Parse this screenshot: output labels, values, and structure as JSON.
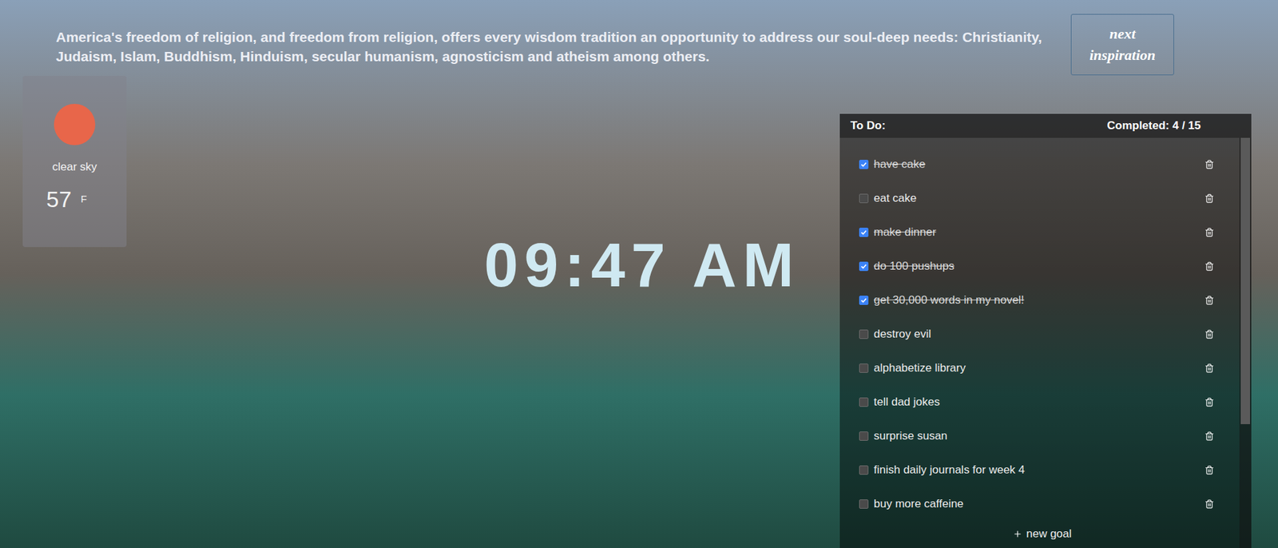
{
  "quote": {
    "text": "America's freedom of religion, and freedom from religion, offers every wisdom tradition an opportunity to address our soul-deep needs: Christianity, Judaism, Islam, Buddhism, Hinduism, secular humanism, agnosticism and atheism among others."
  },
  "next_button": {
    "label": "next inspiration"
  },
  "weather": {
    "description": "clear sky",
    "temperature": "57",
    "unit": "F"
  },
  "clock": {
    "time": "09:47 AM"
  },
  "todo": {
    "title": "To Do:",
    "completed_label": "Completed: 4 / 15",
    "items": [
      {
        "text": "have cake",
        "checked": true
      },
      {
        "text": "eat cake",
        "checked": false
      },
      {
        "text": "make dinner",
        "checked": true
      },
      {
        "text": "do 100 pushups",
        "checked": true
      },
      {
        "text": "get 30,000 words in my novel!",
        "checked": true
      },
      {
        "text": "destroy evil",
        "checked": false
      },
      {
        "text": "alphabetize library",
        "checked": false
      },
      {
        "text": "tell dad jokes",
        "checked": false
      },
      {
        "text": "surprise susan",
        "checked": false
      },
      {
        "text": "finish daily journals for week 4",
        "checked": false
      },
      {
        "text": "buy more caffeine",
        "checked": false
      }
    ],
    "new_goal": "new goal"
  }
}
